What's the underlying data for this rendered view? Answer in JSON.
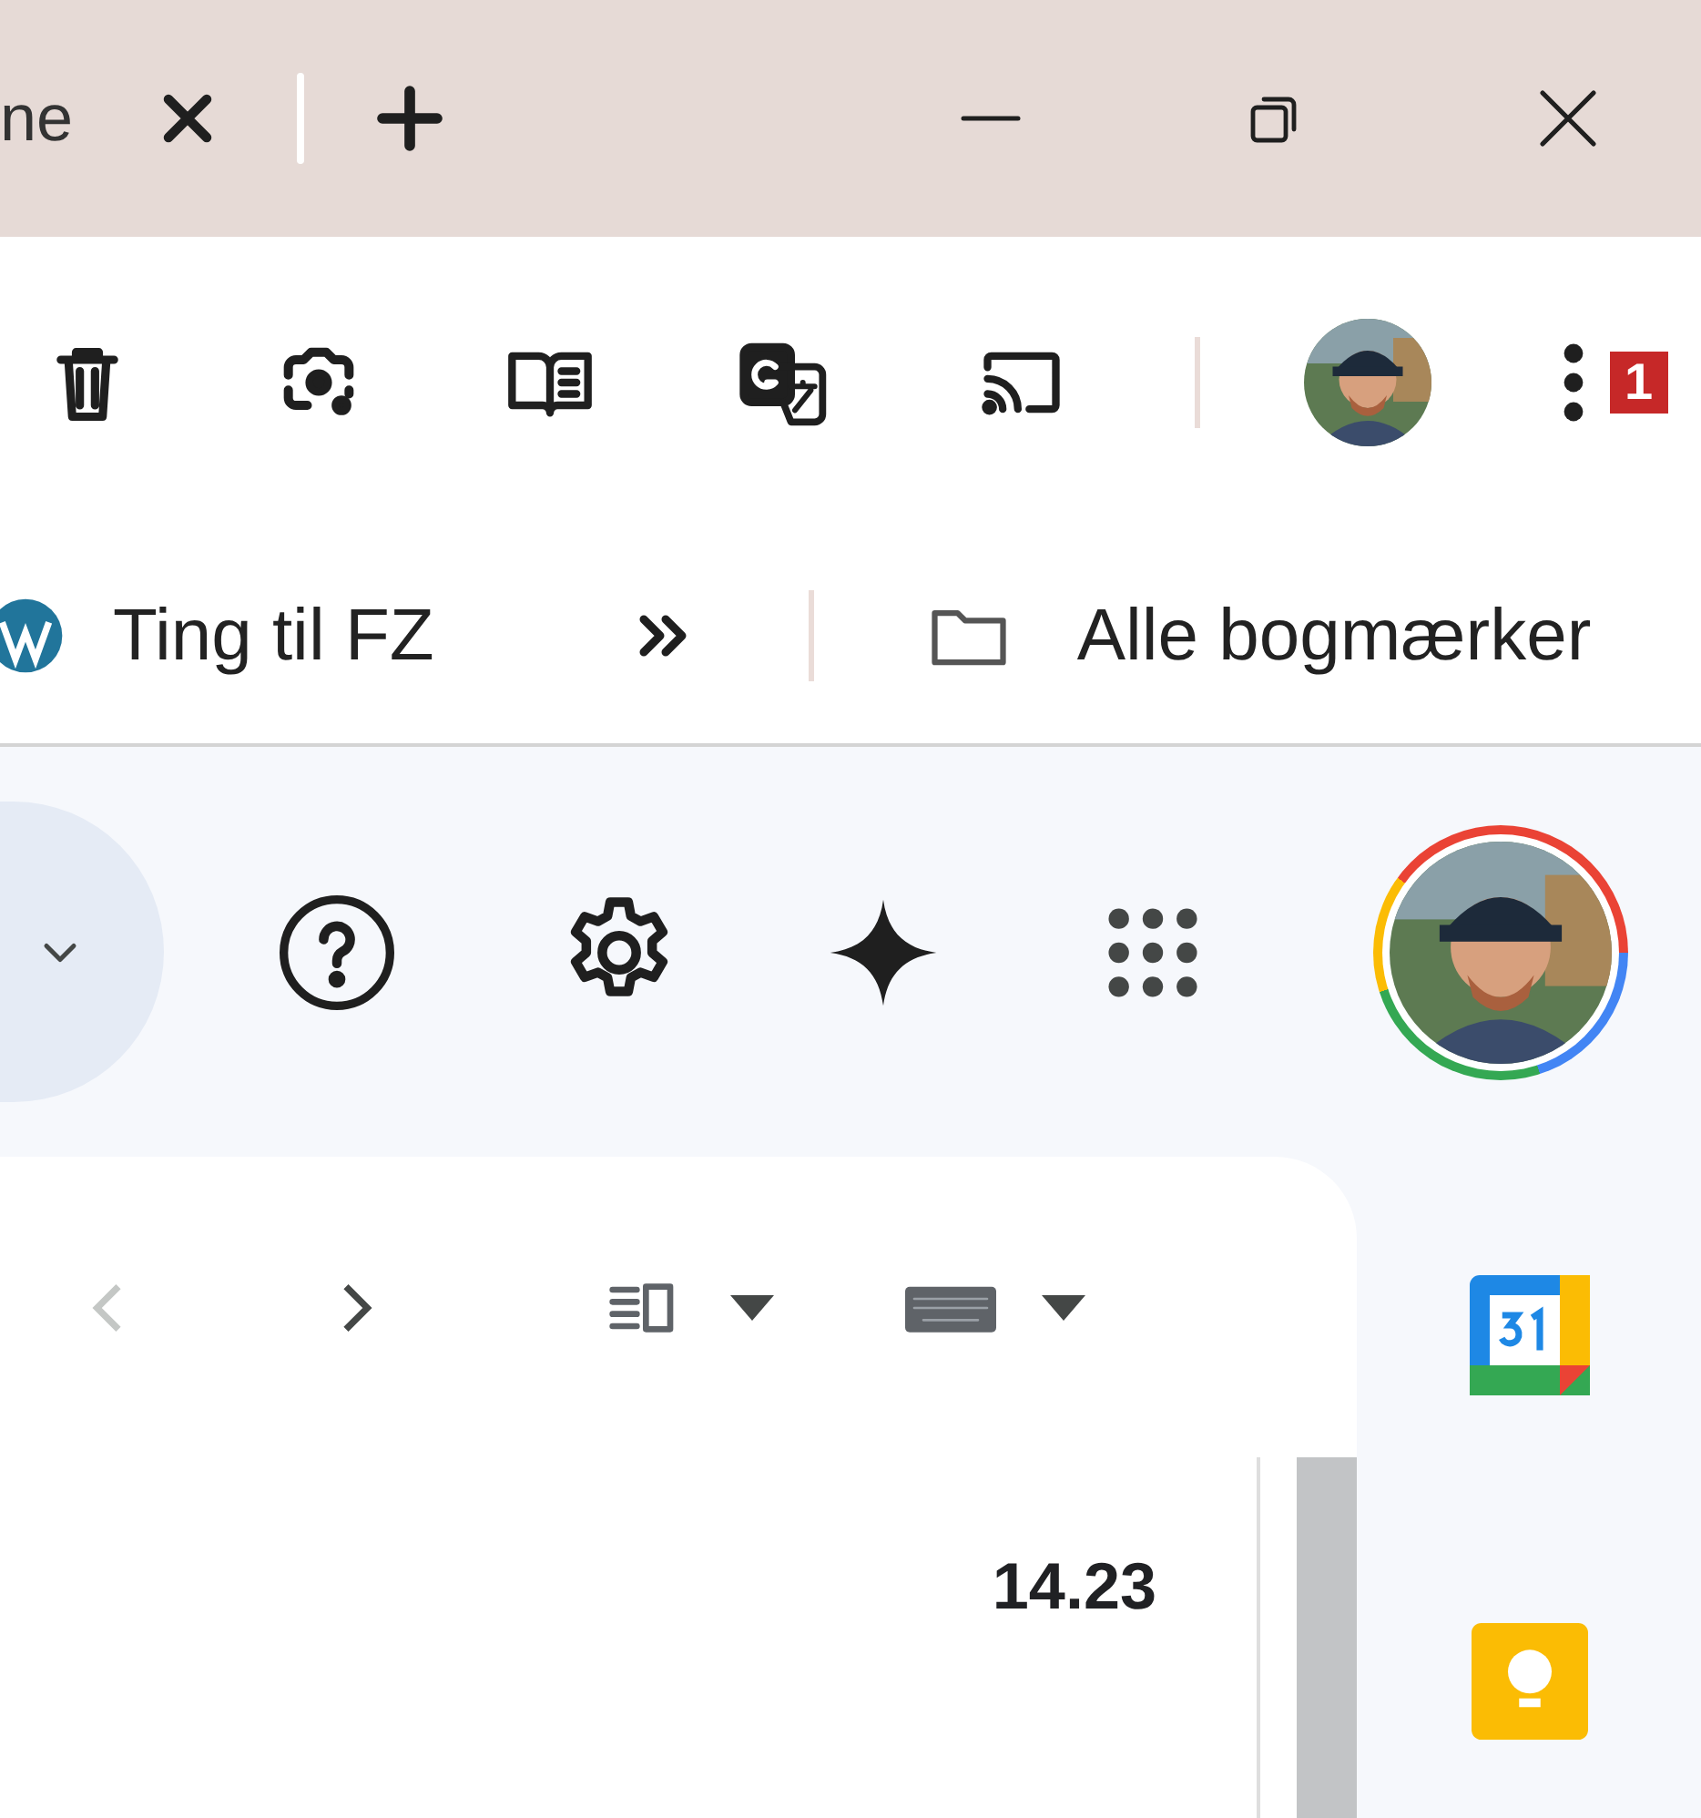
{
  "tab_strip": {
    "tab_title": "ne"
  },
  "toolbar": {
    "badge": "1"
  },
  "bookmarks": [
    {
      "kind": "site",
      "label": "Ting til FZ"
    },
    {
      "kind": "overflow"
    },
    {
      "kind": "folder",
      "label": "Alle bogmærker"
    }
  ],
  "mail": {
    "nav": [
      {
        "kind": "prev",
        "disabled": true
      },
      {
        "kind": "next",
        "disabled": false
      }
    ],
    "rows": [
      {
        "time": "14.23",
        "unread": true
      }
    ]
  }
}
